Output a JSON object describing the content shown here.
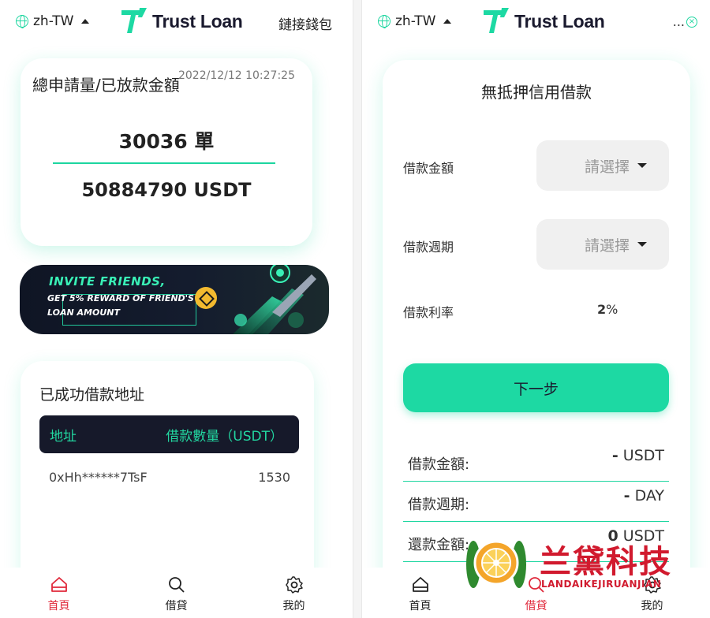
{
  "left": {
    "header": {
      "lang": "zh-TW",
      "brand": "Trust Loan",
      "connect": "鏈接錢包"
    },
    "stats": {
      "title": "總申請量/已放款金額",
      "timestamp": "2022/12/12 10:27:25",
      "count": "30036 單",
      "amount": "50884790 USDT"
    },
    "banner": {
      "line1": "INVITE FRIENDS,",
      "line2": "GET 5% REWARD OF FRIEND'S",
      "line3": "LOAN AMOUNT"
    },
    "loans": {
      "title": "已成功借款地址",
      "col_address": "地址",
      "col_amount": "借款數量（USDT）",
      "rows": [
        {
          "address": "0xHh******7TsF",
          "amount": "1530"
        }
      ]
    },
    "nav": {
      "home": "首頁",
      "loan": "借貸",
      "mine": "我的",
      "active": "home"
    }
  },
  "right": {
    "header": {
      "lang": "zh-TW",
      "brand": "Trust Loan",
      "more": "..."
    },
    "form": {
      "title": "無抵押信用借款",
      "amount_label": "借款金額",
      "amount_placeholder": "請選擇",
      "period_label": "借款週期",
      "period_placeholder": "請選擇",
      "rate_label": "借款利率",
      "rate_value": "2",
      "rate_unit": "%",
      "next_button": "下一步"
    },
    "summary": [
      {
        "key": "借款金額:",
        "value": "-",
        "unit": "USDT"
      },
      {
        "key": "借款週期:",
        "value": "-",
        "unit": "DAY"
      },
      {
        "key": "還款金額:",
        "value": "0",
        "unit": "USDT"
      }
    ],
    "nav": {
      "home": "首頁",
      "loan": "借貸",
      "mine": "我的",
      "active": "loan"
    }
  },
  "watermark": {
    "title": "兰黛科技",
    "subtitle": "LANDAIKEJIRUANJIAN"
  },
  "colors": {
    "accent": "#1dd9a3",
    "nav_active": "#e0293b",
    "dark": "#16192a",
    "watermark": "#d11a2e"
  }
}
